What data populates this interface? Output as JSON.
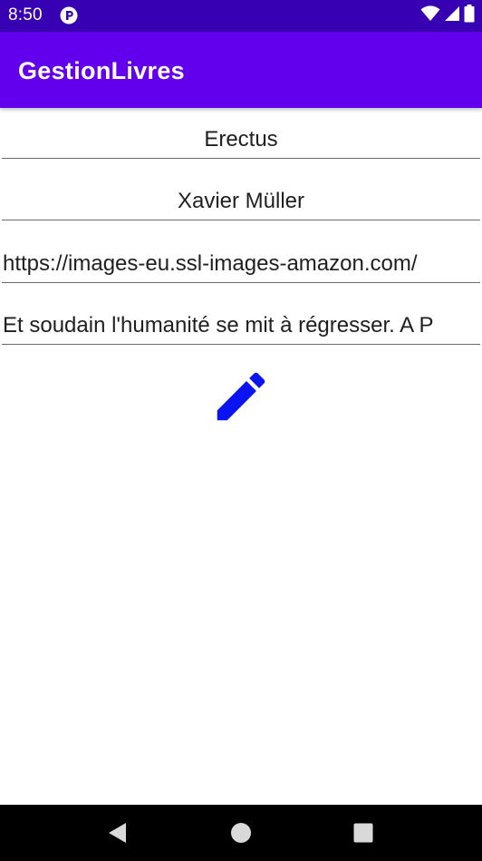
{
  "status_bar": {
    "time": "8:50",
    "icons": [
      "app-notification-icon",
      "wifi-icon",
      "signal-icon",
      "battery-icon"
    ]
  },
  "app_bar": {
    "title": "GestionLivres"
  },
  "form": {
    "title_value": "Erectus",
    "author_value": "Xavier Müller",
    "image_url_value": "https://images-eu.ssl-images-amazon.com/",
    "description_value": "Et soudain l'humanité se mit à régresser. A P"
  },
  "edit_button": {
    "icon": "pencil-icon",
    "color": "#0a14f0"
  },
  "nav_bar": {
    "icons": [
      "back-icon",
      "home-icon",
      "recents-icon"
    ]
  },
  "colors": {
    "status_bar": "#3700b3",
    "app_bar": "#6200ee",
    "accent_icon": "#0a14f0"
  }
}
